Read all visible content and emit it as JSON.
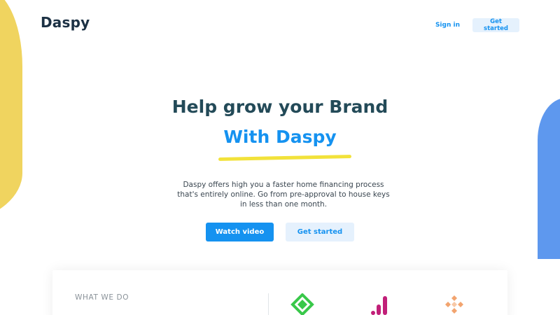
{
  "header": {
    "logo": "Daspy",
    "sign_in": "Sign in",
    "get_started": "Get started"
  },
  "hero": {
    "title": "Help grow your Brand",
    "subtitle": "With Daspy",
    "description": "Daspy offers high you a faster home financing process that's entirely online. Go from pre-approval to house keys in less than one month.",
    "watch_video": "Watch video",
    "get_started": "Get started"
  },
  "what_we_do": {
    "label": "WHAT WE DO",
    "icons": [
      "green-diamond-icon",
      "bar-chart-icon",
      "orange-diamond-grid-icon"
    ]
  },
  "colors": {
    "accent": "#1592f0",
    "heading": "#234a58",
    "yellow": "#f0d45f",
    "blue_blob": "#5e98ee",
    "underline": "#f2e23a"
  }
}
